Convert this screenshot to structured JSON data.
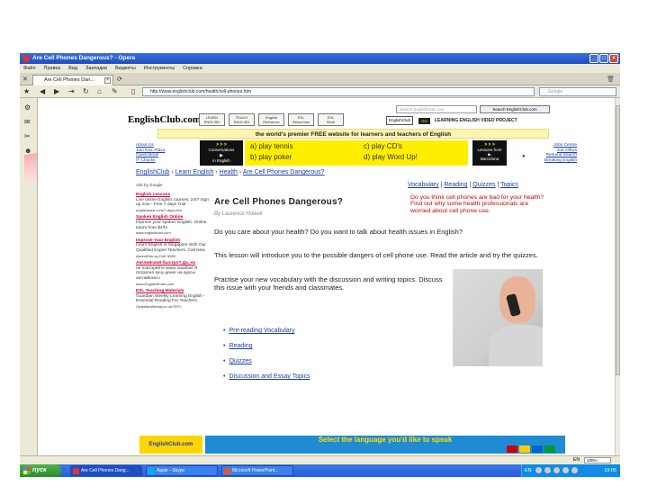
{
  "window": {
    "title": "Are Cell Phones Dangerous? - Opera",
    "controls": [
      "_",
      "□",
      "×"
    ]
  },
  "menu": [
    "Файл",
    "Правка",
    "Вид",
    "Закладки",
    "Виджеты",
    "Инструменты",
    "Справка"
  ],
  "tab": {
    "label": "Are Cell Phones Dan...",
    "close": "×"
  },
  "nav": {
    "url": "http://www.englishclub.com/health/cell-phones.htm",
    "search_placeholder": "Google"
  },
  "site": {
    "logo": "EnglishClub.com",
    "search_placeholder": "Search EnglishClub.com",
    "search_button": "Search EnglishClub.com",
    "nav_boxes": [
      {
        "line1": "LEARN",
        "line2": "ENGLISH"
      },
      {
        "line1": "TEACH",
        "line2": "ENGLISH"
      },
      {
        "line1": "English",
        "line2": "Reference"
      },
      {
        "line1": "ESL",
        "line2": "Resources"
      },
      {
        "line1": "ESL",
        "line2": "Work"
      }
    ],
    "english_club_box": "EnglishClub",
    "video_button": "GO",
    "video_text": "LEARNING ENGLISH VIDEO PROJECT",
    "banner": "the world's premier FREE website for learners and teachers of English"
  },
  "side_links_left": [
    "About Us",
    "Join ESL Plaza",
    "Guest Book",
    "IT Chocks"
  ],
  "side_links_right": [
    "Jobs Centre",
    "Job Offers",
    "Resume Search",
    "Breaking English"
  ],
  "ad_banner": {
    "left_arrows": "> > >",
    "left_text": "Conversations",
    "left_sub": "in English",
    "opt_a": "a) play tennis",
    "opt_b": "b) play poker",
    "opt_c": "c) play CD's",
    "opt_d": "d) play Word Up!",
    "right_arrows": "> > >",
    "right_text": "Lessons from",
    "right_sub": "Barcelona"
  },
  "breadcrumb": [
    "EnglishClub",
    "Learn English",
    "Health",
    "Are Cell Phones Dangerous?"
  ],
  "breadcrumb_sep": "›",
  "ads_label": "Ads by Google",
  "left_ads": [
    {
      "title": "English Lessons",
      "body": "Live online English courses, 24/7 Sign up now - Free 7 days Trial",
      "url": "englishtown.com/7-days-free"
    },
    {
      "title": "Spoken English Online",
      "body": "Improve your spoken English. Online tutors from $4/hr",
      "url": "www.englishtutor.com"
    },
    {
      "title": "Improve Your English",
      "body": "Learn English in Singapore With Our Qualified Expert Teachers. Call Now",
      "url": "AscentEdu.sg Call: 5085"
    },
    {
      "title": "Английский быстро? Да, но",
      "body": "не повторяйте моих ошибок! Я потратил кучу денег на курсы английского",
      "url": "www.EnglishSmart.com"
    },
    {
      "title": "ESL Teaching Materials",
      "body": "Guardian Weekly Learning English - Essential Reading For Teachers",
      "url": "GuardianWeekly.co.uk/TEFL"
    }
  ],
  "top_tabs": [
    "Vocabulary",
    "Reading",
    "Quizzes",
    "Topics"
  ],
  "top_tabs_sep": "|",
  "article": {
    "title": "Are Cell Phones Dangerous?",
    "byline": "By Laurence Howell",
    "warning": "Do you think cell phones are bad for your health? Find out why some health professionals are worried about cell phone use.",
    "p1": "Do you care about your health? Do you want to talk about health issues in English?",
    "p2": "This lesson will introduce you to the possible dangers of cell phone use. Read the article and try the quizzes.",
    "p3": "Practise your new vocabulary with the discussion and writing topics. Discuss this issue with your friends and classmates.",
    "links": [
      "Pre-reading Vocabulary",
      "Reading",
      "Quizzes",
      "Discussion and Essay Topics"
    ]
  },
  "bottom": {
    "logo": "EnglishClub.com",
    "banner": "Select the language you'd like to speak"
  },
  "status": {
    "zoom": "100%",
    "lang": "EN"
  },
  "taskbar": {
    "start": "пуск",
    "tasks": [
      "Are Cell Phones Dang...",
      "Apple - Skype",
      "Microsoft PowerPoint..."
    ],
    "tray_lang": "EN",
    "clock": "19:05"
  },
  "colors": {
    "titlebar": "#245edb",
    "banner": "#fff5b0",
    "link": "#1a3fa0",
    "warning_text": "#cc0000",
    "ad_yellow": "#ffee00",
    "bottom_banner": "#1f8bd4"
  }
}
